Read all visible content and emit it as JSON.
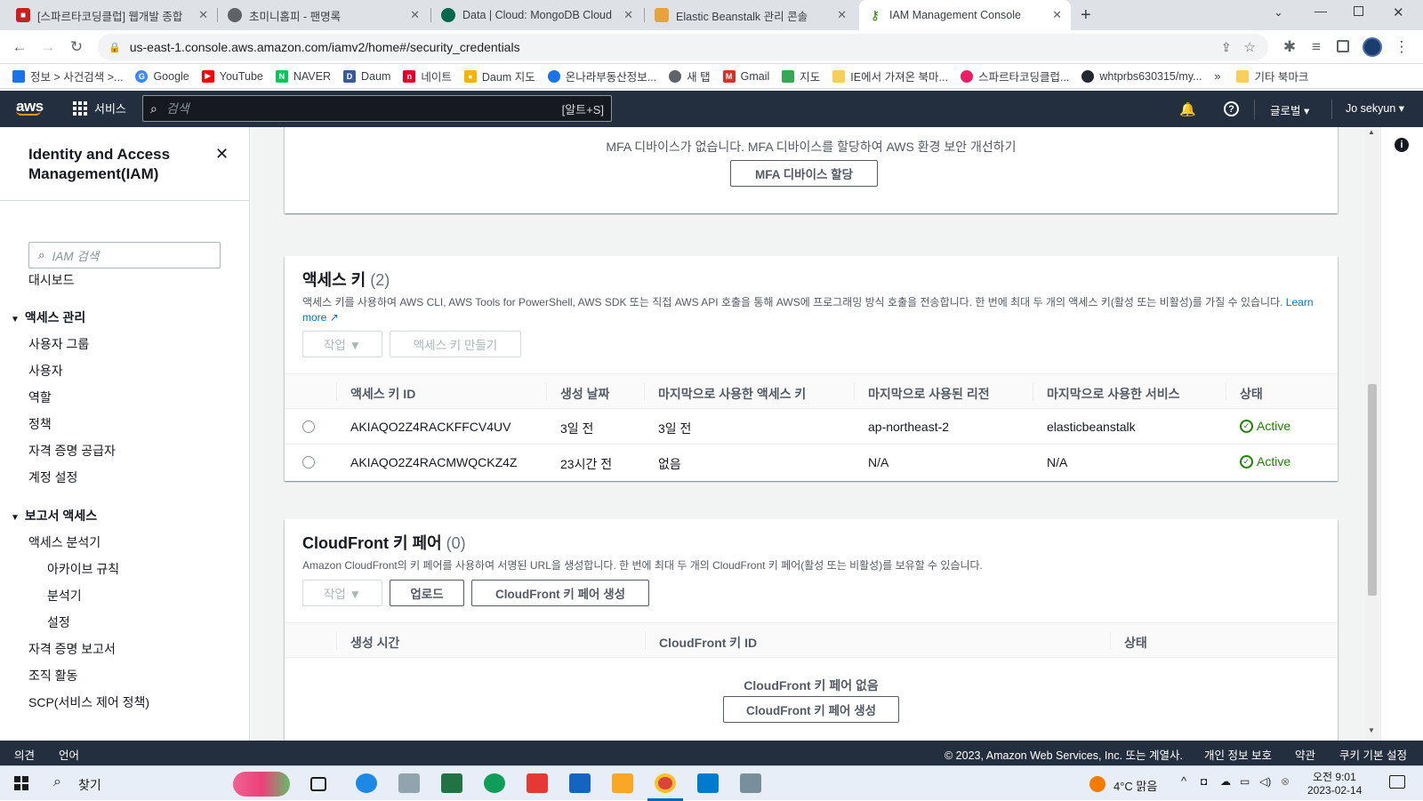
{
  "browser": {
    "tabs": [
      {
        "title": "[스파르타코딩클럽] 웹개발 종합",
        "color": "#c5221f"
      },
      {
        "title": "초미니홈피 - 팬명록",
        "color": "#5f6368"
      },
      {
        "title": "Data | Cloud: MongoDB Cloud",
        "color": "#00684a"
      },
      {
        "title": "Elastic Beanstalk 관리 콘솔",
        "color": "#e8a33d"
      },
      {
        "title": "IAM Management Console",
        "color": "#1d8102"
      }
    ],
    "url": "us-east-1.console.aws.amazon.com/iamv2/home#/security_credentials",
    "bookmarks": [
      {
        "label": "정보 > 사건검색 >...",
        "color": "#1a73e8"
      },
      {
        "label": "Google",
        "color": "#4285f4"
      },
      {
        "label": "YouTube",
        "color": "#ff0000"
      },
      {
        "label": "NAVER",
        "color": "#03c75a"
      },
      {
        "label": "Daum",
        "color": "#3b5998"
      },
      {
        "label": "네이트",
        "color": "#e4002b"
      },
      {
        "label": "Daum 지도",
        "color": "#f4b400"
      },
      {
        "label": "온나라부동산정보...",
        "color": "#1a73e8"
      },
      {
        "label": "새 탭",
        "color": "#5f6368"
      },
      {
        "label": "Gmail",
        "color": "#d93025"
      },
      {
        "label": "지도",
        "color": "#34a853"
      },
      {
        "label": "IE에서 가져온 북마...",
        "color": "#f9ce5b"
      },
      {
        "label": "스파르타코딩클럽...",
        "color": "#e91e63"
      },
      {
        "label": "whtprbs630315/my...",
        "color": "#24292f"
      }
    ],
    "bookmarks_more": "»",
    "other_bookmarks": "기타 북마크"
  },
  "aws_nav": {
    "logo": "aws",
    "services": "서비스",
    "search_placeholder": "검색",
    "search_shortcut": "[알트+S]",
    "region": "글로벌 ▾",
    "user": "Jo sekyun ▾"
  },
  "sidebar": {
    "title": "Identity and Access Management(IAM)",
    "close": "✕",
    "search_placeholder": "IAM 검색",
    "dashboard": "대시보드",
    "section1": "액세스 관리",
    "section1_items": [
      "사용자 그룹",
      "사용자",
      "역할",
      "정책",
      "자격 증명 공급자",
      "계정 설정"
    ],
    "section2": "보고서 액세스",
    "analyzer": "액세스 분석기",
    "analyzer_items": [
      "아카이브 규칙",
      "분석기",
      "설정"
    ],
    "section2_items": [
      "자격 증명 보고서",
      "조직 활동",
      "SCP(서비스 제어 정책)"
    ]
  },
  "mfa": {
    "message": "MFA 디바이스가 없습니다. MFA 디바이스를 할당하여 AWS 환경 보안 개선하기",
    "button": "MFA 디바이스 할당"
  },
  "access_keys": {
    "title": "액세스 키",
    "count": "(2)",
    "description": "액세스 키를 사용하여 AWS CLI, AWS Tools for PowerShell, AWS SDK 또는 직접 AWS API 호출을 통해 AWS에 프로그래밍 방식 호출을 전송합니다. 한 번에 최대 두 개의 액세스 키(활성 또는 비활성)를 가질 수 있습니다.",
    "learn_more": "Learn more",
    "actions_button": "작업 ▼",
    "create_button": "액세스 키 만들기",
    "columns": [
      "액세스 키 ID",
      "생성 날짜",
      "마지막으로 사용한 액세스 키",
      "마지막으로 사용된 리전",
      "마지막으로 사용한 서비스",
      "상태"
    ],
    "rows": [
      [
        "AKIAQO2Z4RACKFFCV4UV",
        "3일 전",
        "3일 전",
        "ap-northeast-2",
        "elasticbeanstalk",
        "Active"
      ],
      [
        "AKIAQO2Z4RACMWQCKZ4Z",
        "23시간 전",
        "없음",
        "N/A",
        "N/A",
        "Active"
      ]
    ]
  },
  "cloudfront": {
    "title": "CloudFront 키 페어",
    "count": "(0)",
    "description": "Amazon CloudFront의 키 페어를 사용하여 서명된 URL을 생성합니다. 한 번에 최대 두 개의 CloudFront 키 페어(활성 또는 비활성)를 보유할 수 있습니다.",
    "actions_button": "작업 ▼",
    "upload_button": "업로드",
    "create_button": "CloudFront 키 페어 생성",
    "columns": [
      "생성 시간",
      "CloudFront 키 ID",
      "상태"
    ],
    "empty_text": "CloudFront 키 페어 없음",
    "empty_button": "CloudFront 키 페어 생성"
  },
  "footer": {
    "feedback": "의견",
    "language": "언어",
    "copyright": "© 2023, Amazon Web Services, Inc. 또는 계열사.",
    "privacy": "개인 정보 보호",
    "terms": "약관",
    "cookies": "쿠키 기본 설정"
  },
  "taskbar": {
    "search": "찾기",
    "weather": "4°C 맑음",
    "time": "오전 9:01",
    "date": "2023-02-14"
  }
}
